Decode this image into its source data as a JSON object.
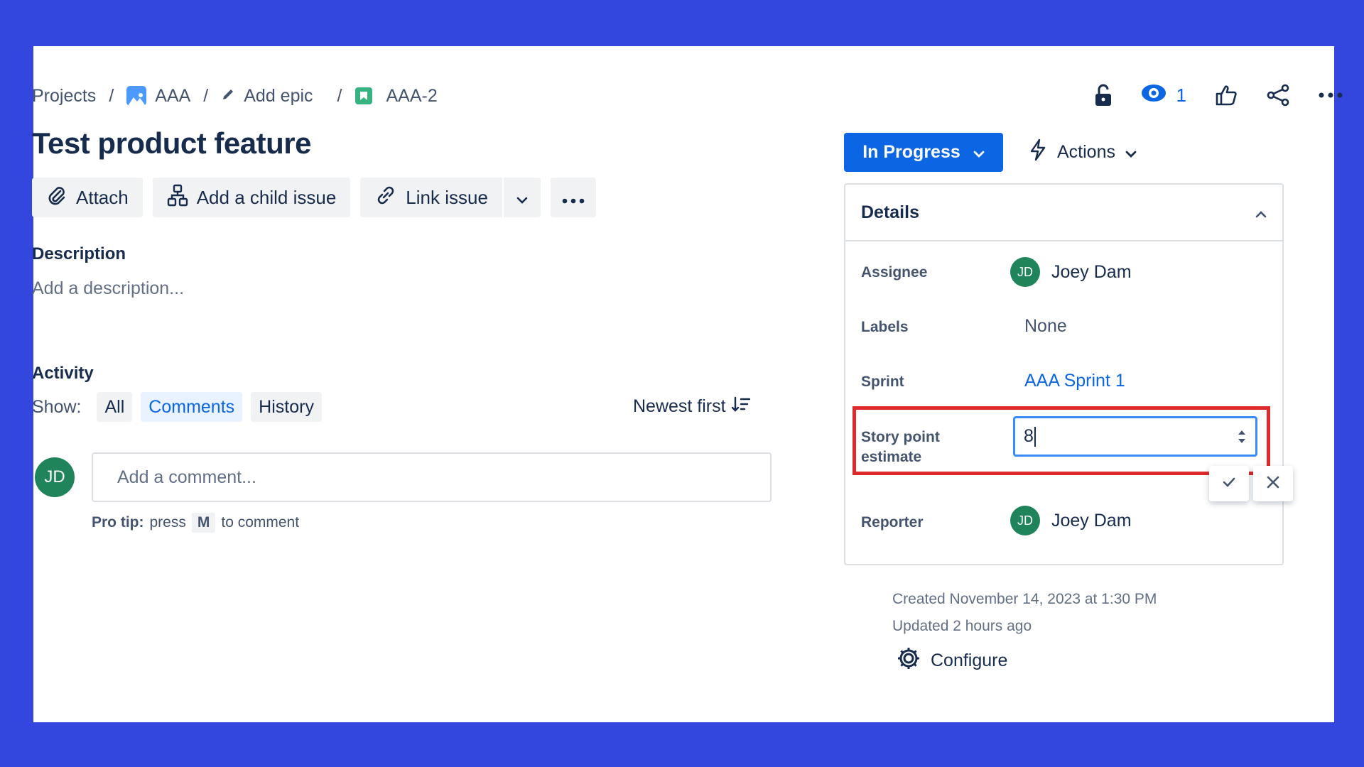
{
  "colors": {
    "background": "#3346dd",
    "accent": "#0c66e4",
    "highlight": "#dd2a2a",
    "avatar": "#1f845a"
  },
  "breadcrumb": {
    "projects": "Projects",
    "project": "AAA",
    "epic": "Add epic",
    "issue_key": "AAA-2",
    "separator": "/"
  },
  "header_icons": {
    "watch_count": "1",
    "icons": [
      "unlock-icon",
      "eye-icon",
      "thumbs-up-icon",
      "share-icon",
      "more-icon"
    ]
  },
  "issue": {
    "title": "Test product feature"
  },
  "toolbar": {
    "attach": "Attach",
    "add_child": "Add a child issue",
    "link_issue": "Link issue"
  },
  "description": {
    "heading": "Description",
    "placeholder": "Add a description..."
  },
  "activity": {
    "heading": "Activity",
    "show_label": "Show:",
    "filters": [
      "All",
      "Comments",
      "History"
    ],
    "active_filter": "Comments",
    "sort": "Newest first"
  },
  "comment": {
    "avatar_initials": "JD",
    "placeholder": "Add a comment...",
    "protip_bold": "Pro tip:",
    "protip_press": "press",
    "protip_key": "M",
    "protip_rest": "to comment"
  },
  "status": {
    "label": "In Progress"
  },
  "actions": {
    "label": "Actions"
  },
  "details": {
    "heading": "Details",
    "assignee": {
      "label": "Assignee",
      "initials": "JD",
      "name": "Joey Dam"
    },
    "labels": {
      "label": "Labels",
      "value": "None"
    },
    "sprint": {
      "label": "Sprint",
      "value": "AAA Sprint 1"
    },
    "story_points": {
      "label_line1": "Story point",
      "label_line2": "estimate",
      "value": "8"
    },
    "reporter": {
      "label": "Reporter",
      "initials": "JD",
      "name": "Joey Dam"
    }
  },
  "meta": {
    "created": "Created November 14, 2023 at 1:30 PM",
    "updated": "Updated 2 hours ago",
    "configure": "Configure"
  }
}
